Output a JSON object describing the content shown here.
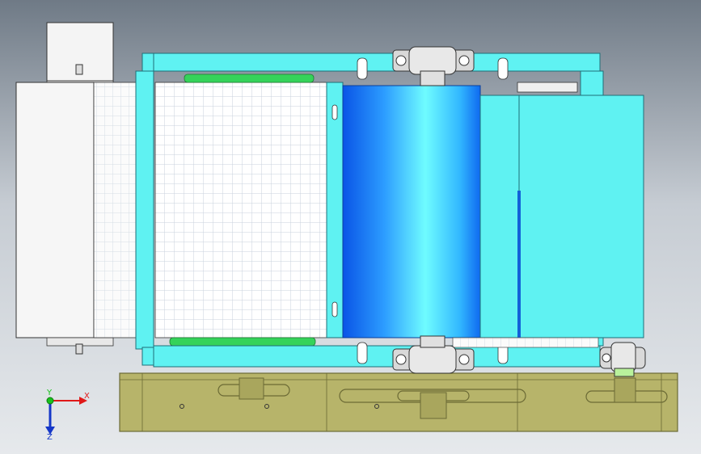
{
  "viewport": {
    "background_top": "#6f7a86",
    "background_mid": "#c6ccd3",
    "background_bottom": "#e6e9ec"
  },
  "colors": {
    "frame_cyan": "#5ff2f2",
    "frame_edge": "#1f6f78",
    "drum_blue": "#1e8fff",
    "drum_light": "#6ffcff",
    "base_olive": "#b7b46a",
    "base_edge": "#6b6a35",
    "mesh_white": "#ffffff",
    "guard_white": "#f4f4f4",
    "belt_green": "#35d35a",
    "bearing_grey": "#d9d9d9"
  },
  "triad": {
    "x_label": "X",
    "y_label": "Y",
    "z_label": "Z",
    "x_color": "#e01818",
    "y_color": "#19c21d",
    "z_color": "#1537c8"
  }
}
